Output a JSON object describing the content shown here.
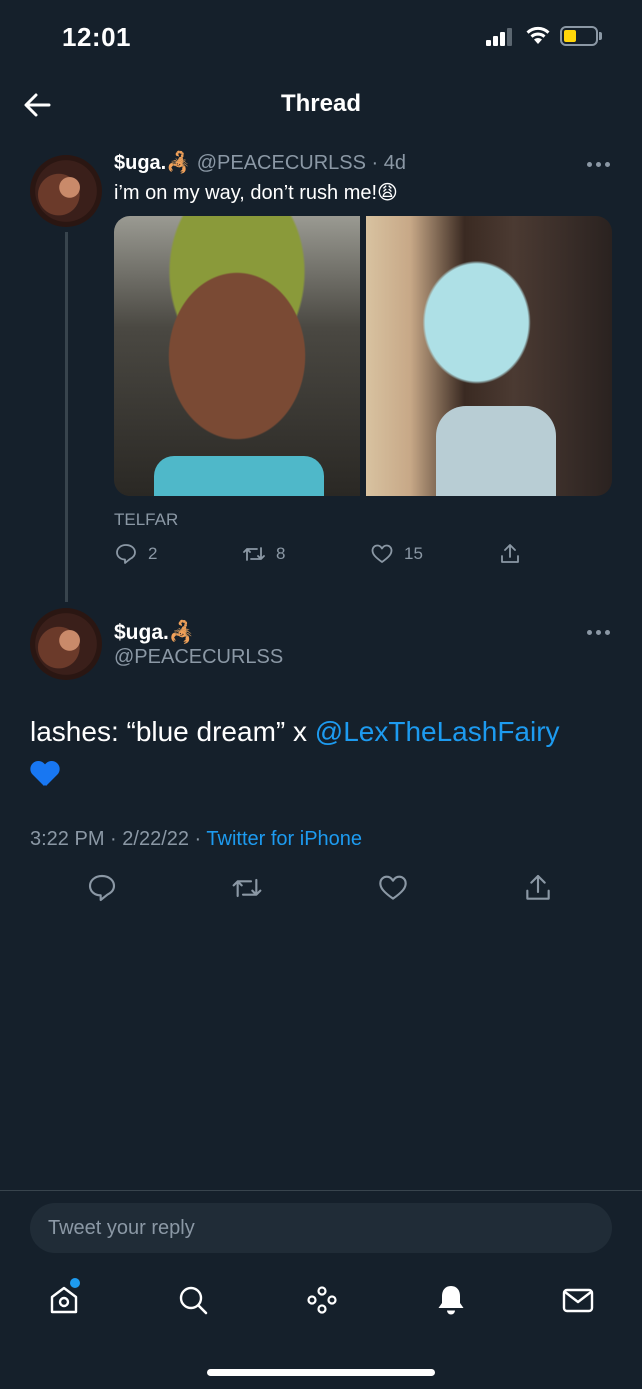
{
  "status_bar": {
    "time": "12:01"
  },
  "header": {
    "title": "Thread"
  },
  "tweet_main": {
    "display_name": "$uga.",
    "name_emoji": "🦂",
    "handle": "@PEACECURLSS",
    "age": "· 4d",
    "text": "i’m on my way, don’t rush me!",
    "text_emoji": "😩",
    "media_caption": "TELFAR",
    "counts": {
      "replies": "2",
      "retweets": "8",
      "likes": "15"
    }
  },
  "tweet_reply": {
    "display_name": "$uga.",
    "name_emoji": "🦂",
    "handle": "@PEACECURLSS",
    "text_prefix": "lashes: “blue dream” x ",
    "mention": "@LexTheLashFairy",
    "time": "3:22 PM",
    "date": "2/22/22",
    "source": "Twitter for iPhone"
  },
  "reply_bar": {
    "placeholder": "Tweet your reply"
  },
  "icons": {
    "back": "arrow-left-icon",
    "more": "more-horizontal-icon",
    "reply": "comment-icon",
    "retweet": "retweet-icon",
    "like": "heart-icon",
    "share": "share-icon",
    "nav": [
      "home-icon",
      "search-icon",
      "spaces-icon",
      "notifications-icon",
      "messages-icon"
    ]
  },
  "colors": {
    "background": "#15202b",
    "accent": "#1d9bf0",
    "muted": "#8b98a5",
    "divider": "#38444d"
  }
}
